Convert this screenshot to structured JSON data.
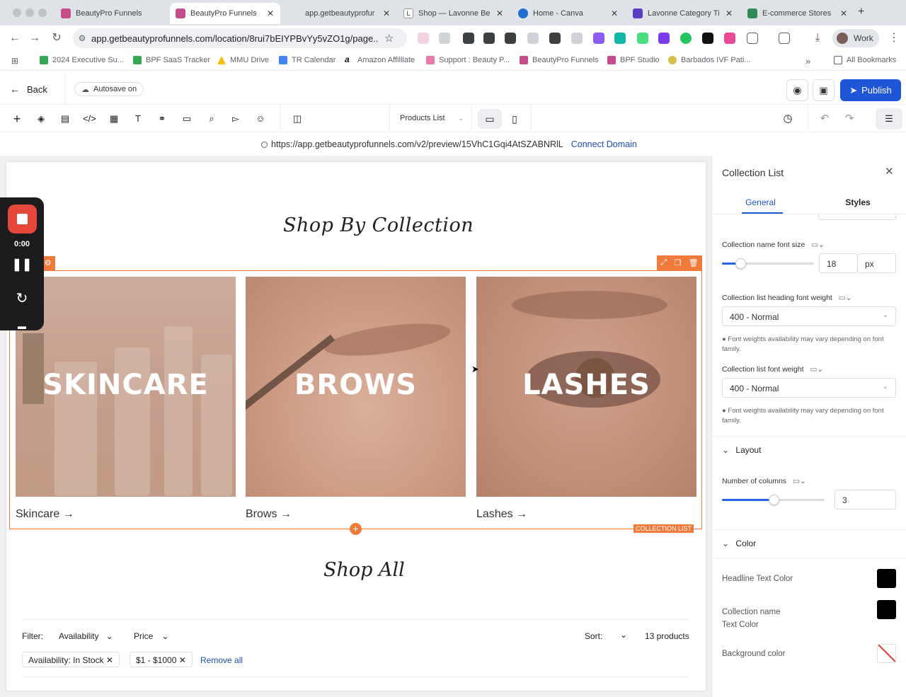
{
  "browser": {
    "tabs": [
      {
        "label": "BeautyPro Funnels",
        "color": "#c44d8a"
      },
      {
        "label": "BeautyPro Funnels",
        "color": "#c44d8a",
        "active": true
      },
      {
        "label": "app.getbeautyprofur",
        "color": ""
      },
      {
        "label": "Shop — Lavonne Be",
        "color": "#333"
      },
      {
        "label": "Home - Canva",
        "color": "#1f6ed4"
      },
      {
        "label": "Lavonne Category Ti",
        "color": "#5b3cc4"
      },
      {
        "label": "E-commerce Stores",
        "color": "#2e8b57"
      }
    ],
    "new_tab": "+",
    "url": "app.getbeautyprofunnels.com/location/8rui7bEIYPBvYy5vZO1g/page...",
    "profile_label": "Work",
    "bookmarks": [
      "2024 Executive Su...",
      "BPF SaaS Tracker",
      "MMU Drive",
      "TR Calendar",
      "Amazon Affilliate",
      "Support : Beauty P...",
      "BeautyPro Funnels",
      "BPF Studio",
      "Barbados IVF Pati..."
    ],
    "bookmarks_more": "»",
    "all_bookmarks": "All Bookmarks"
  },
  "editor": {
    "back_label": "Back",
    "autosave_label": "Autosave on",
    "publish_label": "Publish",
    "page_select": "Products List",
    "preview_url": "https://app.getbeautyprofunnels.com/v2/preview/15VhC1Gqi4AtSZABNRlL",
    "connect_domain": "Connect Domain"
  },
  "canvas": {
    "heading1": "Shop By Collection",
    "cards": [
      {
        "word": "SKINCARE",
        "link": "Skincare →"
      },
      {
        "word": "BROWS",
        "link": "Brows →"
      },
      {
        "word": "LASHES",
        "link": "Lashes →"
      }
    ],
    "collection_tag": "COLLECTION LIST",
    "heading2": "Shop All",
    "filter_label": "Filter:",
    "availability_label": "Availability",
    "price_label": "Price",
    "sort_label": "Sort:",
    "product_count": "13 products",
    "chip_availability": "Availability: In Stock",
    "chip_price": "$1 - $1000",
    "remove_all": "Remove all"
  },
  "recorder": {
    "time": "0:00"
  },
  "panel": {
    "title": "Collection List",
    "tab_general": "General",
    "tab_styles": "Styles",
    "name_font_size_label": "Collection name font size",
    "name_font_size_value": "18",
    "name_font_size_unit": "px",
    "name_font_size_fraction": 0.2,
    "heading_weight_label": "Collection list heading font weight",
    "heading_weight_value": "400 - Normal",
    "weight_note": "Font weights availability may vary depending on font family.",
    "list_weight_label": "Collection list font weight",
    "list_weight_value": "400 - Normal",
    "layout_section": "Layout",
    "columns_label": "Number of columns",
    "columns_value": "3",
    "columns_fraction": 0.5,
    "color_section": "Color",
    "headline_color_label": "Headline Text Color",
    "collection_name_color_label_1": "Collection name",
    "collection_name_color_label_2": "Text Color",
    "background_color_label": "Background color",
    "accent_color": "#2563eb"
  }
}
